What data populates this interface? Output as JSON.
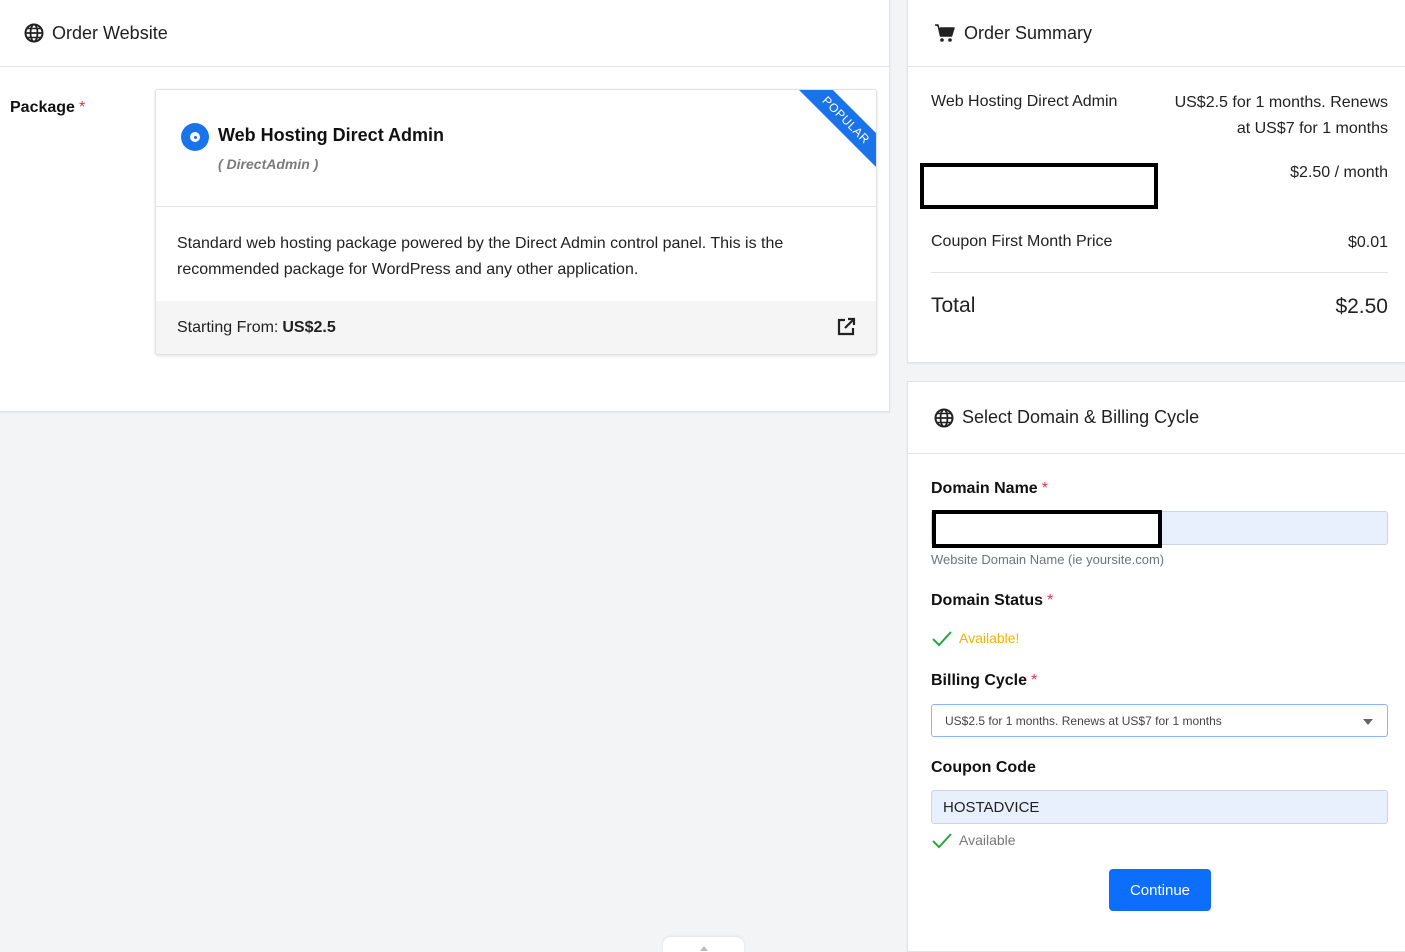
{
  "order_website": {
    "title": "Order Website",
    "icon": "globe-icon",
    "package_label": "Package",
    "required_mark": "*",
    "package": {
      "name": "Web Hosting Direct Admin",
      "subtitle": "( DirectAdmin )",
      "ribbon": "POPULAR",
      "description": "Standard web hosting package powered by the Direct Admin control panel. This is the recommended package for WordPress and any other application.",
      "starting_from_label": "Starting From:",
      "starting_from_price": "US$2.5",
      "accent_color": "#1a73e8"
    }
  },
  "order_summary": {
    "title": "Order Summary",
    "icon": "cart-icon",
    "item_name": "Web Hosting Direct Admin",
    "item_price": "US$2.5 for 1 months. Renews at US$7 for 1 months",
    "monthly_price": "$2.50 / month",
    "coupon_label": "Coupon First Month Price",
    "coupon_price": "$0.01",
    "total_label": "Total",
    "total_value": "$2.50"
  },
  "domain_billing": {
    "title": "Select Domain & Billing Cycle",
    "icon": "globe-icon",
    "domain_name_label": "Domain Name",
    "domain_help": "Website Domain Name (ie yoursite.com)",
    "domain_status_label": "Domain Status",
    "domain_status_value": "Available!",
    "domain_status_color": "#f0b400",
    "billing_cycle_label": "Billing Cycle",
    "billing_cycle_value": "US$2.5 for 1 months. Renews at US$7 for 1 months",
    "coupon_code_label": "Coupon Code",
    "coupon_code_value": "HOSTADVICE",
    "coupon_status": "Available",
    "continue_label": "Continue",
    "button_color": "#0d6efd"
  }
}
